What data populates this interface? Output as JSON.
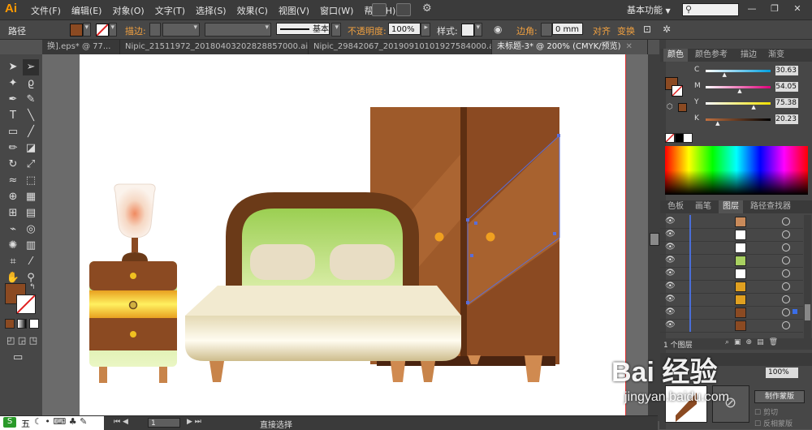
{
  "app": {
    "logo": "Ai",
    "menu": [
      "文件(F)",
      "编辑(E)",
      "对象(O)",
      "文字(T)",
      "选择(S)",
      "效果(C)",
      "视图(V)",
      "窗口(W)",
      "帮助(H)"
    ],
    "workspace_label": "基本功能",
    "workspace_arrow": "▼",
    "window_controls": [
      "—",
      "❐",
      "✕"
    ]
  },
  "control_bar": {
    "selection_type": "路径",
    "stroke_label": "描边:",
    "stroke_style": "基本",
    "opacity_label": "不透明度:",
    "opacity_value": "100%",
    "style_label": "样式:",
    "corner_label": "边角:",
    "corner_value": "0 mm",
    "align_label": "对齐",
    "transform_label": "变换",
    "colors": {
      "fill": "#8b4a22",
      "stroke": "#ffffff"
    }
  },
  "tabs": [
    {
      "label": "换].eps* @ 77...",
      "active": false
    },
    {
      "label": "Nipic_21511972_20180403202828857000.ai*",
      "active": false
    },
    {
      "label": "Nipic_29842067_20190910101927584000.ai*",
      "active": false
    },
    {
      "label": "未标题-3* @ 200% (CMYK/预览)",
      "active": true
    }
  ],
  "tab_close": "✕",
  "color_panel": {
    "tabs": [
      "颜色",
      "颜色参考",
      "描边",
      "渐变"
    ],
    "channels": [
      {
        "name": "C",
        "value": "30.63",
        "pct": 0.306,
        "from": "#ffffff",
        "to": "#00a0e0"
      },
      {
        "name": "M",
        "value": "54.05",
        "pct": 0.54,
        "from": "#ffffff",
        "to": "#e0007a"
      },
      {
        "name": "Y",
        "value": "75.38",
        "pct": 0.754,
        "from": "#ffffff",
        "to": "#f0e000"
      },
      {
        "name": "K",
        "value": "20.23",
        "pct": 0.202,
        "from": "#c07040",
        "to": "#000000"
      }
    ],
    "fill_color": "#8b4a22"
  },
  "layers_panel": {
    "tabs": [
      "色板",
      "画笔",
      "图层",
      "路径查找器"
    ],
    "layer_count": "1 个图层",
    "rows": [
      {
        "thumb": "#c98a5a"
      },
      {
        "thumb": "#ffffff"
      },
      {
        "thumb": "#ffffff"
      },
      {
        "thumb": "#a8d060"
      },
      {
        "thumb": "#ffffff"
      },
      {
        "thumb": "#e0a020"
      },
      {
        "thumb": "#e0a020"
      },
      {
        "thumb": "#8b4a22"
      },
      {
        "thumb": "#8b4a22"
      }
    ]
  },
  "transparency_panel": {
    "opacity": "100%",
    "make_mask": "制作蒙版",
    "clip": "剪切",
    "invert_mask": "反相蒙版"
  },
  "status": {
    "page": "1",
    "tool": "直接选择"
  },
  "watermark": {
    "brand": "Bai 经验",
    "url": "jingyan.baidu.com"
  },
  "ime": {
    "label": "五"
  }
}
